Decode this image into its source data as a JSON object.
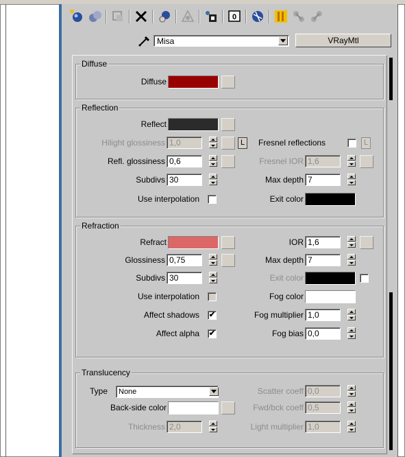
{
  "toolbar": {
    "buttons": [
      {
        "icon": "get-material-icon"
      },
      {
        "icon": "put-to-scene-icon"
      },
      {
        "icon": "assign-to-selection-icon"
      },
      {
        "icon": "reset-map-icon"
      },
      {
        "icon": "make-unique-icon"
      },
      {
        "icon": "put-to-library-icon"
      },
      {
        "icon": "material-effects-channel-icon"
      },
      {
        "icon": "show-map-in-viewport-icon"
      },
      {
        "icon": "show-end-result-icon"
      },
      {
        "icon": "go-to-parent-icon"
      },
      {
        "icon": "go-forward-to-sibling-icon"
      },
      {
        "icon": "material-navigator-icon"
      }
    ]
  },
  "material": {
    "name": "Misa",
    "type": "VRayMtl"
  },
  "diffuse": {
    "group_title": "Diffuse",
    "label": "Diffuse",
    "color": "#990000"
  },
  "reflection": {
    "group_title": "Reflection",
    "reflect_label": "Reflect",
    "reflect_color": "#2b2b2b",
    "hilight_label": "Hilight glossiness",
    "hilight_value": "1,0",
    "l_button": "L",
    "fresnel_label": "Fresnel reflections",
    "fresnel_l": "L",
    "refl_gloss_label": "Refl. glossiness",
    "refl_gloss_value": "0,6",
    "fresnel_ior_label": "Fresnel IOR",
    "fresnel_ior_value": "1,6",
    "subdivs_label": "Subdivs",
    "subdivs_value": "30",
    "max_depth_label": "Max depth",
    "max_depth_value": "7",
    "use_interp_label": "Use interpolation",
    "exit_color_label": "Exit color",
    "exit_color": "#000000"
  },
  "refraction": {
    "group_title": "Refraction",
    "refract_label": "Refract",
    "refract_color": "#dd6666",
    "ior_label": "IOR",
    "ior_value": "1,6",
    "gloss_label": "Glossiness",
    "gloss_value": "0,75",
    "max_depth_label": "Max depth",
    "max_depth_value": "7",
    "subdivs_label": "Subdivs",
    "subdivs_value": "30",
    "exit_color_label": "Exit color",
    "exit_color": "#000000",
    "use_interp_label": "Use interpolation",
    "fog_color_label": "Fog color",
    "fog_color": "#ffffff",
    "affect_shadows_label": "Affect shadows",
    "affect_shadows_check": "✔",
    "fog_mult_label": "Fog multiplier",
    "fog_mult_value": "1,0",
    "affect_alpha_label": "Affect alpha",
    "affect_alpha_check": "✔",
    "fog_bias_label": "Fog bias",
    "fog_bias_value": "0,0"
  },
  "translucency": {
    "group_title": "Translucency",
    "type_label": "Type",
    "type_value": "None",
    "scatter_label": "Scatter coeff",
    "scatter_value": "0,0",
    "backside_label": "Back-side color",
    "backside_color": "#ffffff",
    "fwd_bck_label": "Fwd/bck coeff",
    "fwd_bck_value": "0,5",
    "thickness_label": "Thickness",
    "thickness_value": "2,0",
    "light_mult_label": "Light multiplier",
    "light_mult_value": "1,0"
  }
}
